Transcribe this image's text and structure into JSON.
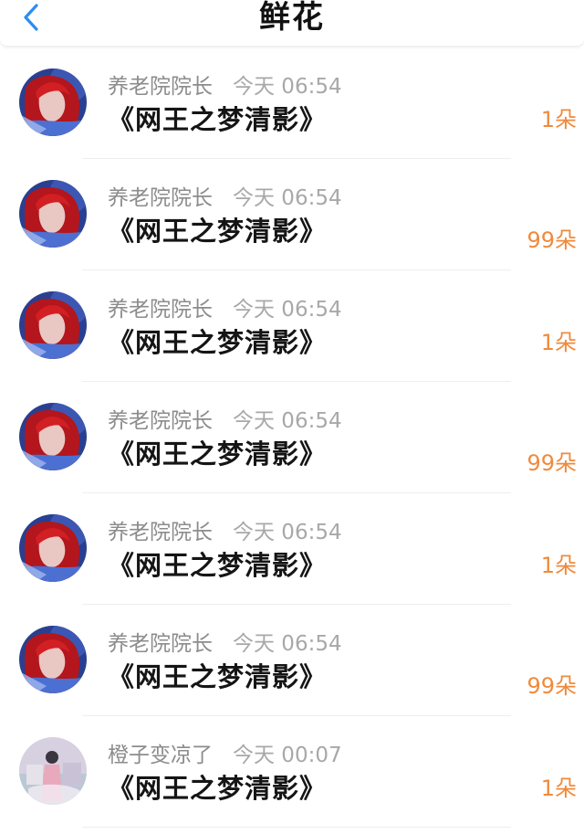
{
  "header": {
    "title": "鲜花",
    "back_icon": "chevron-left-icon",
    "accent": "#2d8cf0"
  },
  "colors": {
    "count": "#f08a3c",
    "meta": "#8c8c8c"
  },
  "items": [
    {
      "user": "养老院院长",
      "time": "今天 06:54",
      "book": "《网王之梦清影》",
      "count": "1朵",
      "avatar": "red"
    },
    {
      "user": "养老院院长",
      "time": "今天 06:54",
      "book": "《网王之梦清影》",
      "count": "99朵",
      "avatar": "red"
    },
    {
      "user": "养老院院长",
      "time": "今天 06:54",
      "book": "《网王之梦清影》",
      "count": "1朵",
      "avatar": "red"
    },
    {
      "user": "养老院院长",
      "time": "今天 06:54",
      "book": "《网王之梦清影》",
      "count": "99朵",
      "avatar": "red"
    },
    {
      "user": "养老院院长",
      "time": "今天 06:54",
      "book": "《网王之梦清影》",
      "count": "1朵",
      "avatar": "red"
    },
    {
      "user": "养老院院长",
      "time": "今天 06:54",
      "book": "《网王之梦清影》",
      "count": "99朵",
      "avatar": "red"
    },
    {
      "user": "橙子变凉了",
      "time": "今天 00:07",
      "book": "《网王之梦清影》",
      "count": "1朵",
      "avatar": "pink"
    }
  ]
}
